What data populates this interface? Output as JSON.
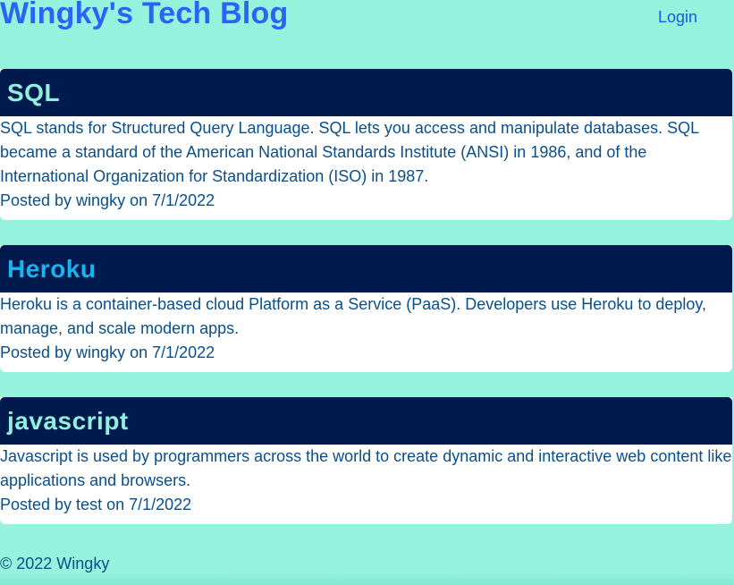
{
  "header": {
    "title": "Wingky's Tech Blog",
    "login_label": "Login"
  },
  "posts": [
    {
      "title": "SQL",
      "title_color": "#8ff0dd",
      "content": "SQL stands for Structured Query Language. SQL lets you access and manipulate databases. SQL became a standard of the American National Standards Institute (ANSI) in 1986, and of the International Organization for Standardization (ISO) in 1987.",
      "meta": "Posted by wingky on 7/1/2022"
    },
    {
      "title": "Heroku",
      "title_color": "#1ab3f0",
      "content": "Heroku is a container-based cloud Platform as a Service (PaaS). Developers use Heroku to deploy, manage, and scale modern apps.",
      "meta": "Posted by wingky on 7/1/2022"
    },
    {
      "title": "javascript",
      "title_color": "#8ff0dd",
      "content": "Javascript is used by programmers across the world to create dynamic and interactive web content like applications and browsers.",
      "meta": "Posted by test on 7/1/2022"
    }
  ],
  "footer": {
    "text": "© 2022 Wingky"
  },
  "colors": {
    "background": "#95f2dc",
    "title_blue": "#2a63f5",
    "post_header_bg": "#001a4d",
    "body_text": "#0a4f8a"
  }
}
